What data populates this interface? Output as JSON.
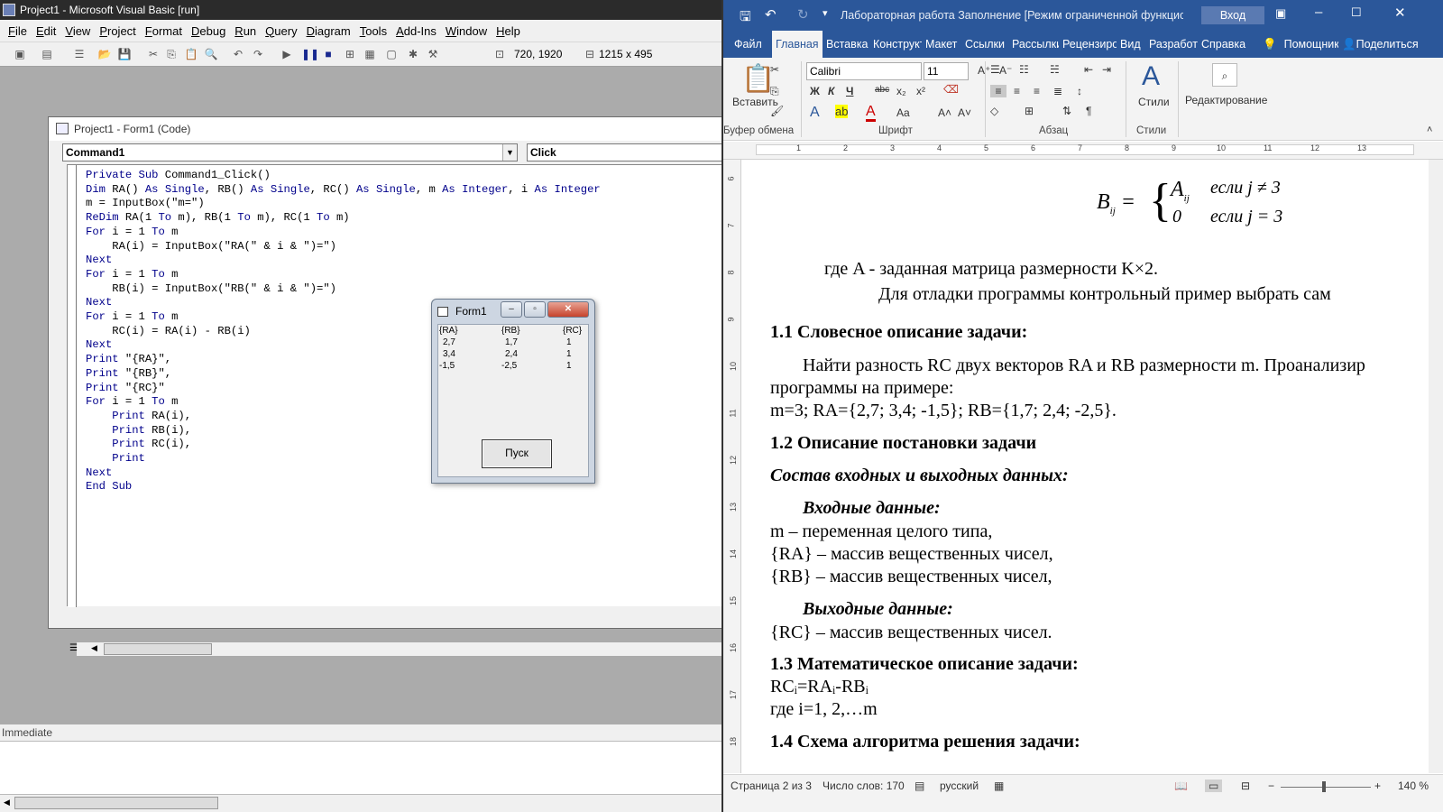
{
  "vb": {
    "title": "Project1 - Microsoft Visual Basic [run]",
    "menu": [
      "File",
      "Edit",
      "View",
      "Project",
      "Format",
      "Debug",
      "Run",
      "Query",
      "Diagram",
      "Tools",
      "Add-Ins",
      "Window",
      "Help"
    ],
    "toolbar": {
      "position": "720, 1920",
      "size": "1215 x 495"
    },
    "code_window": {
      "title": "Project1 - Form1 (Code)",
      "object_combo": "Command1",
      "proc_combo": "Click"
    },
    "form1": {
      "title": "Form1",
      "headers": [
        "{RA}",
        "{RB}",
        "{RC}"
      ],
      "rows": [
        [
          "2,7",
          "1,7",
          "1"
        ],
        [
          "3,4",
          "2,4",
          "1"
        ],
        [
          "-1,5",
          "-2,5",
          "1"
        ]
      ],
      "button": "Пуск"
    },
    "immediate": {
      "title": "Immediate"
    }
  },
  "code_lines": [
    "Private Sub Command1_Click()",
    "Dim RA() As Single, RB() As Single, RC() As Single, m As Integer, i As Integer",
    "m = InputBox(\"m=\")",
    "ReDim RA(1 To m), RB(1 To m), RC(1 To m)",
    "For i = 1 To m",
    "    RA(i) = InputBox(\"RA(\" & i & \")=\")",
    "Next",
    "For i = 1 To m",
    "    RB(i) = InputBox(\"RB(\" & i & \")=\")",
    "Next",
    "For i = 1 To m",
    "    RC(i) = RA(i) - RB(i)",
    "Next",
    "Print \"{RA}\",",
    "Print \"{RB}\",",
    "Print \"{RC}\"",
    "For i = 1 To m",
    "    Print RA(i),",
    "    Print RB(i),",
    "    Print RC(i),",
    "    Print",
    "Next",
    "End Sub"
  ],
  "word": {
    "title": "Лабораторная работа Заполнение [Режим ограниченной функциона...",
    "login": "Вход",
    "tabs": [
      "Файл",
      "Главная",
      "Вставка",
      "Конструктор",
      "Макет",
      "Ссылки",
      "Рассылки",
      "Рецензирование",
      "Вид",
      "Разработчик",
      "Справка",
      "Помощник",
      "Поделиться"
    ],
    "ribbon": {
      "paste": "Вставить",
      "font_name": "Calibri",
      "font_size": "11",
      "styles": "Стили",
      "editing": "Редактирование",
      "groups": [
        "Буфер обмена",
        "Шрифт",
        "Абзац",
        "Стили"
      ]
    },
    "ruler_numbers": [
      "1",
      "1",
      "2",
      "3",
      "4",
      "5",
      "6",
      "7",
      "8",
      "9",
      "10",
      "11",
      "12",
      "13"
    ],
    "vruler_numbers": [
      "6",
      "7",
      "8",
      "9",
      "10",
      "11",
      "12",
      "13",
      "14",
      "15",
      "16",
      "17",
      "18"
    ],
    "doc": {
      "formula_lhs": "B",
      "formula_sub": "ij",
      "formula_case1_val": "A",
      "formula_case1_sub": "ij",
      "formula_case1_cond": "если j ≠ 3",
      "formula_case2_val": "0",
      "formula_case2_cond": "если j = 3",
      "line1": "где A - заданная матрица размерности K×2.",
      "line2": "Для отладки программы контрольный пример выбрать сам",
      "h1": "1.1 Словесное описание задачи:",
      "p1a": "Найти разность RC двух векторов RA и RB размерности m. Проанализир",
      "p1b": "программы на примере:",
      "p1c": "m=3; RA={2,7; 3,4; -1,5}; RB={1,7; 2,4; -2,5}.",
      "h2": "1.2  Описание постановки задачи",
      "h2sub": "Состав входных и выходных данных:",
      "in_title": "Входные данные:",
      "in1": "m – переменная целого типа,",
      "in2": "{RA} – массив вещественных чисел,",
      "in3": "{RB} – массив вещественных чисел,",
      "out_title": "Выходные данные:",
      "out1": "{RC} – массив вещественных чисел.",
      "h3": "1.3 Математическое описание задачи:",
      "math1": "RCᵢ=RAᵢ-RBᵢ",
      "math2": "где i=1, 2,…m",
      "h4": "1.4 Схема алгоритма решения задачи:"
    },
    "status": {
      "page": "Страница 2 из 3",
      "words": "Число слов: 170",
      "lang": "русский",
      "zoom": "140 %"
    }
  }
}
